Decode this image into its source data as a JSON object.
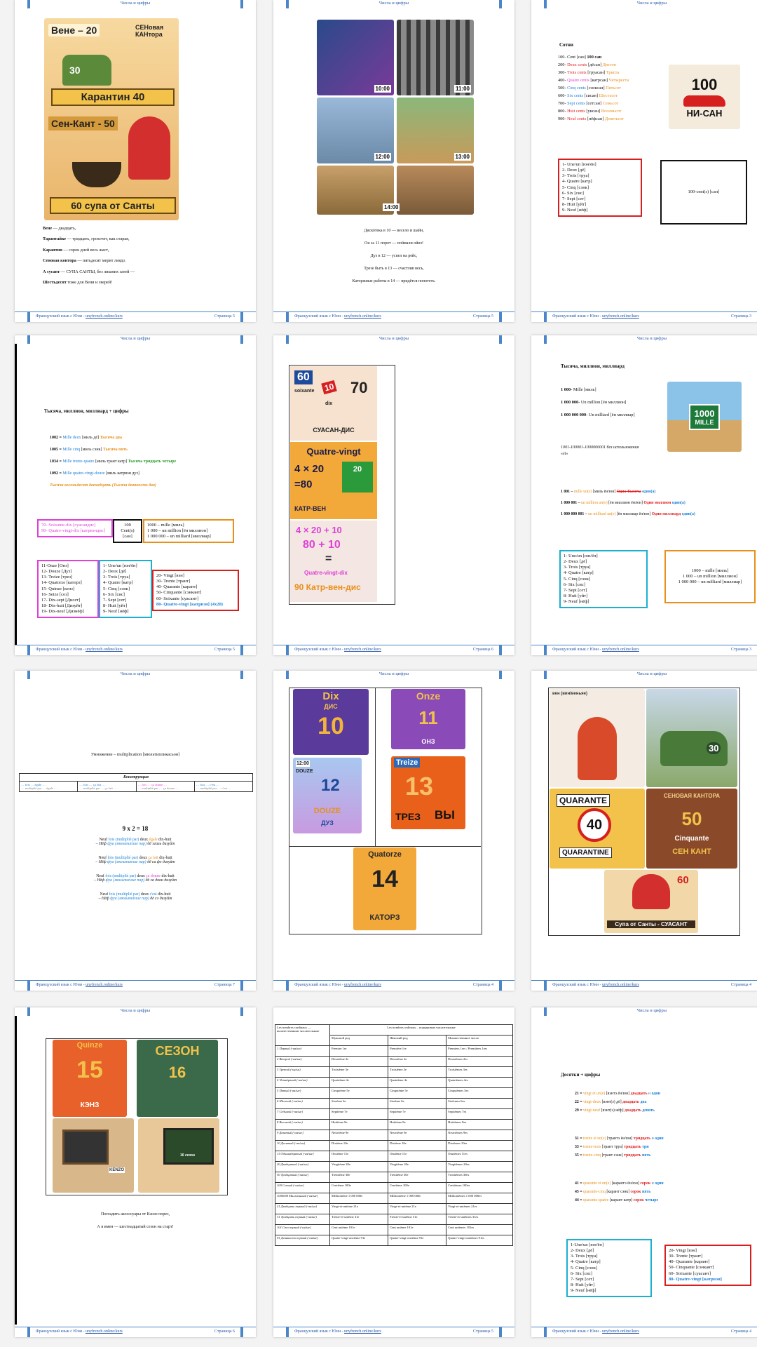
{
  "header_title": "Числа и цифры",
  "header_title_alt": "Числа и цифры",
  "footer": {
    "text": "Французский язык с Юни - ",
    "link": "unyfrench.online/kurs"
  },
  "colors": {
    "accent": "#4a86c8",
    "red": "#e02020",
    "blue": "#1a7fd6",
    "orange": "#e8901a",
    "pink": "#e040d8"
  },
  "p1": {
    "page_num": "Страница 5",
    "img": {
      "t1": "Вене – 20",
      "t2": "СЕНовая КАНтора",
      "car": "30",
      "quarantine": "Карантин 40",
      "sen": "Сен-Кант - 50",
      "soup": "60 супа от Санты"
    },
    "lines": [
      [
        "Вене",
        " — двадцать,"
      ],
      [
        "Тарантайке",
        " — тридцать, грохочет, как старая,"
      ],
      [
        "Карантин",
        " — сорок дней весь жаст,"
      ],
      [
        "Сеновая контора",
        " — пятьдесят мерит лиядз."
      ],
      [
        "А сусант",
        " — СУПА САНТЫ, без лишних затей —"
      ],
      [
        "Шестьдесят",
        " тоже для Вени и зверей!"
      ]
    ]
  },
  "p2": {
    "page_num": "Страница 5",
    "times": [
      "10:00",
      "11:00",
      "12:00",
      "13:00",
      "14:00"
    ],
    "lines": [
      "Дискотека в 10 — весело и шайн,",
      "Он за 11 порот — поймали ойнз!",
      "Дуз в 12 — успел на рейс,",
      "Трезе быть в 13 — счастлив весь,",
      "Каторжные работы в 14 — придётся попотеть."
    ]
  },
  "p3": {
    "page_num": "Страница 3",
    "title": "Сотни",
    "rows": [
      [
        "100- ",
        "Cent [сан] ",
        "100 сан",
        ""
      ],
      [
        "200- ",
        "Deux cents ",
        "[дёсан] ",
        "Двести"
      ],
      [
        "300- ",
        "Trois cents ",
        "[труасан] ",
        "Триста"
      ],
      [
        "400- ",
        "Quatre cents ",
        "[катрсан] ",
        "Четыреста"
      ],
      [
        "500- ",
        "Cinq cents ",
        "[сэнксан] ",
        "Пятьсот"
      ],
      [
        "600- ",
        "Six cents ",
        "[сисан] ",
        "Шестьсот"
      ],
      [
        "700- ",
        "Sept cents ",
        "[сетсан] ",
        "Семьсот"
      ],
      [
        "800- ",
        "Huit cents ",
        "[уисан] ",
        "Восемьсот"
      ],
      [
        "900- ",
        "Neuf cents ",
        "[нёфсан] ",
        "Девятьсот"
      ]
    ],
    "badge": {
      "num": "100",
      "txt": "НИ-САН"
    },
    "box_list": [
      "1- Une/un [юн/ён]",
      "2- Deux [дё]",
      "3- Trois [труа]",
      "4- Quatre [катр]",
      "5- Cinq [сэнк]",
      "6- Six [сис]",
      "7- Sept [сет]",
      "8- Huit [уйт]",
      "9- Neuf [нёф]"
    ],
    "box_cent": "100-cent(s) [сан]"
  },
  "p4": {
    "page_num": "Страница 5",
    "title": "Тысяча, миллион, миллиард + цифры",
    "rows": [
      [
        "1002 = ",
        "Mille deux ",
        "[миль дё] ",
        "Тысяча два"
      ],
      [
        "1005 = ",
        "Mille cinq ",
        "[миль сэнк] ",
        "Тысяча пять"
      ],
      [
        "1034 = ",
        "Mille trente-quatre ",
        "[миль трант катр] ",
        "Тысяча тридцать четыре"
      ],
      [
        "1092 = ",
        "Mille quatre-vingt-douze ",
        "[миль катрвэн дуз]",
        ""
      ]
    ],
    "note": "Тысяча восемьдесят двенадцать (Тысяча девяносто два)",
    "b1": [
      "70- Soixante-dix [суасандис]",
      "90- Quatre-vingt-dix [катрвэндис]"
    ],
    "b2": [
      "100",
      "Cent(s)",
      "[сан]"
    ],
    "b3": [
      "1000 – mille [миль]",
      "1 000 – un million [ён миллион]",
      "1 000 000 – un milliard [миллиар]"
    ],
    "b4": [
      "11-Onze [Онз]",
      "12- Douze [Дуз]",
      "13- Treize [трез]",
      "14- Quatorze [каторз]",
      "15- Quinze [кенз]",
      "16- Seize [сез]",
      "17- Dix-sept [Дисет]",
      "18- Dix-huit [Дизуйт]",
      "19- Dix-neuf [Дизнёф]"
    ],
    "b5": [
      "1- Une/un [юн/ён]",
      "2- Deux [дё]",
      "3- Trois [труа]",
      "4- Quatre [катр]",
      "5- Cinq [сэнк]",
      "6- Six [сис]",
      "7- Sept [сет]",
      "8- Huit [уйт]",
      "9- Neuf [нёф]"
    ],
    "b6": [
      "20- Vingt [вэн]",
      "30- Trente [трант]",
      "40- Quarante [карант]",
      "50- Cinquante [сэнкант]",
      "60- Soixante [суасант]",
      "80- Quatre-vingt [катрвэн] (4x20)"
    ]
  },
  "p5": {
    "page_num": "Страница 6",
    "a1": "60",
    "a2": "soixante",
    "a3": "10",
    "a4": "dix",
    "a5": "70",
    "a6": "СУАСАН-ДИС",
    "b1": "Quatre-vingt",
    "b2": "4 × 20",
    "b3": "=80",
    "b4": "20",
    "b5": "КАТР-ВЕН",
    "c1": "4 × 20 + 10",
    "c2": "80 + 10",
    "c3": "=",
    "c4": "Quatre-vingt-dix",
    "c5": "90 Катр-вен-дис"
  },
  "p6": {
    "page_num": "Страница 3",
    "title": "Тысяча, миллион, миллиард",
    "rows": [
      [
        "1 000- ",
        "Mille [миль]"
      ],
      [
        "1 000 000- ",
        "Un million [ён миллион]"
      ],
      [
        "1 000 000 000- ",
        "Un milliard [ён миллиар]"
      ]
    ],
    "note": "1001-100001-1000000001 без использования «et»",
    "sign1": "1000",
    "sign2": "MILLE",
    "rows2": [
      [
        "1 001 – ",
        "mille un(e) ",
        "[миль ён/юн] ",
        "Одна Тысяча",
        " один(а)"
      ],
      [
        "1 000 001 – ",
        "un million un(e) ",
        "[ён миллион ён/юн] ",
        "Один миллион",
        " один(а)"
      ],
      [
        "1 000 000 001 – ",
        "un milliard un(e) ",
        "[ён миллиар ён/юн] ",
        "Один миллиард",
        " один(а)"
      ]
    ],
    "box_list": [
      "1- Une/un [юн/ён]",
      "2- Deux [дё]",
      "3- Trois [труа]",
      "4- Quatre [катр]",
      "5- Cinq [сэнк]",
      "6- Six [сис]",
      "7- Sept [сет]",
      "8- Huit [уйт]",
      "9- Neuf [нёф]"
    ],
    "box_big": [
      "1000 – mille [миль]",
      "1 000 – un million [миллион]",
      "1 000 000 – un milliard [миллиар]"
    ]
  },
  "p7": {
    "page_num": "Страница 7",
    "title": "Умножение – multiplication [мюльтипликасьон]",
    "table_title": "Конструкция",
    "cells": [
      "… fois … égale …",
      "… fois … ça fait …",
      "… fois … ça donne …",
      "… fois … c'est …"
    ],
    "cells2": [
      "… multiplié par … égale …",
      "… multiplié par … ça fait …",
      "… multiplié par … ça donne …",
      "… multiplié par … c'est …"
    ],
    "eq": "9 x 2 = 18",
    "ex": [
      [
        "Neuf ",
        "fois (multiplié par) ",
        "deux ",
        "égale ",
        "dix-huit"
      ],
      [
        "– Нёф ",
        "фуа (мюльтиплие пар) ",
        "дё эгаль дизуйт",
        "",
        ""
      ],
      [
        "Neuf ",
        "fois (multiplié par) ",
        "deux ",
        "ça fait ",
        "dix-huit"
      ],
      [
        "– Нёф ",
        "фуа (мюльтиплие пар) ",
        "дё са фэ дизуйт",
        "",
        ""
      ],
      [
        "Neuf ",
        "fois (multiplié par) ",
        "deux ",
        "ça donne ",
        "dix-huit"
      ],
      [
        "– Нёф ",
        "фуа (мюльтиплие пар) ",
        "дё са донн дизуйт",
        "",
        ""
      ],
      [
        "Neuf ",
        "fois (multiplié par) ",
        "deux ",
        "c'est ",
        "dix-huit"
      ],
      [
        "– Нёф ",
        "фуа (мюльтиплие пар) ",
        "дё сэ дизуйт",
        "",
        ""
      ]
    ]
  },
  "p8": {
    "page_num": "Страница 4",
    "a1": "Dix",
    "a2": "ДИС",
    "a3": "10",
    "b1": "Onze",
    "b2": "11",
    "b3": "ОНЗ",
    "c1": "12:00",
    "c2": "DOUZE",
    "c3": "12",
    "c4": "DOUZE",
    "c5": "ДУЗ",
    "d1": "Treize",
    "d2": "13",
    "d3": "ТРЕЗ",
    "d4": "ВЫ",
    "e1": "Quatorze",
    "e2": "14",
    "e3": "КАТОРЗ"
  },
  "p9": {
    "page_num": "Страница 4",
    "a1": "вен (вин/веньяе)",
    "b1": "30",
    "c1": "QUARANTE",
    "c2": "40",
    "c3": "QUARANTINE",
    "d1": "СЕНОВАЯ КАНТОРА",
    "d2": "50",
    "d3": "Cinquante",
    "d4": "СЕН КАНТ",
    "e1": "60",
    "e2": "Супа от Санты - СУАСАНТ"
  },
  "p10": {
    "page_num": "Страница 6",
    "a1": "Quinze",
    "a2": "15",
    "a3": "КЭНЗ",
    "b1": "СЕЗОН",
    "b2": "16",
    "c1": "KENZO",
    "d1": "16 сезон",
    "lines": [
      "Погладить аксессуары от Кэнзо порез,",
      "А я имен — шестнадцатый сезон на старт!"
    ]
  },
  "p11": {
    "page_num": "Страница 5",
    "h1": "Les nombres cardinaux — количественные числительные",
    "h2": "Les nombres ordinaux – порядковые числительные",
    "cols": [
      "Мужской род",
      "Женский род",
      "Множественное число"
    ],
    "rows": [
      [
        "1 Первый (-ая/ые)",
        "Premier 1er",
        "Première 1re",
        "Premiers 1ers / Premières 1res"
      ],
      [
        "2 Второй (-ая/ые)",
        "Deuxième 2e",
        "Deuxième 2e",
        "Deuxièmes 2es"
      ],
      [
        "3 Третий (-ья/ьи)",
        "Troisième 3e",
        "Troisième 3e",
        "Troisièmes 3es"
      ],
      [
        "4 Четвёртый (-ая/ые)",
        "Quatrième 4e",
        "Quatrième 4e",
        "Quatrièmes 4es"
      ],
      [
        "5 Пятый (-ая/ые)",
        "Cinquième 5e",
        "Cinquième 5e",
        "Cinquièmes 5es"
      ],
      [
        "6 Шестой (-ая/ые)",
        "Sixième 6e",
        "Sixième 6e",
        "Sixièmes 6es"
      ],
      [
        "7 Седьмой (-ая/ые)",
        "Septième 7e",
        "Septième 7e",
        "Septièmes 7es"
      ],
      [
        "8 Восьмой (-ая/ые)",
        "Huitième 8e",
        "Huitième 8e",
        "Huitièmes 8es"
      ],
      [
        "9 Девятый (-ая/ые)",
        "Neuvième 9e",
        "Neuvième 9e",
        "Neuvièmes 9es"
      ],
      [
        "10 Десятый (-ая/ые)",
        "Dixième 10e",
        "Dixième 10e",
        "Dixièmes 10es"
      ],
      [
        "11 Одиннадцатый (-ая/ые)",
        "Onzième 11e",
        "Onzième 11e",
        "Onzièmes 11es"
      ],
      [
        "20 Двадцатый (-ая/ые)",
        "Vingtième 20e",
        "Vingtième 20e",
        "Vingtièmes 20es"
      ],
      [
        "30 Тридцатый (-ая/ые)",
        "Trentième 30e",
        "Trentième 30e",
        "Trentièmes 30es"
      ],
      [
        "100 Сотый (-ая/ые)",
        "Centième 100e",
        "Centième 100e",
        "Centièmes 100es"
      ],
      [
        "1000000 Миллионный (-ая/ые)",
        "Millionième 1 000 000e",
        "Millionième 1 000 000e",
        "Millionièmes 1 000 000es"
      ],
      [
        "21 Двадцать первый (-ая/ые)",
        "Vingt-et-unième 21e",
        "Vingt-et-unième 21e",
        "Vingt-et-unièmes 21es"
      ],
      [
        "31 Тридцать первый (-ая/ые)",
        "Trente-et-unième 31e",
        "Trente-et-unième 31e",
        "Trente-et-unièmes 31es"
      ],
      [
        "101 Сто первый (-ая/ые)",
        "Cent unième 101e",
        "Cent unième 101e",
        "Cent unièmes 101es"
      ],
      [
        "91 Девяносто первый (-ая/ые)",
        "Quatre-vingt-onzième 91e",
        "Quatre-vingt-onzième 91e",
        "Quatre-vingt-onzièmes 91es"
      ]
    ]
  },
  "p12": {
    "page_num": "Страница 4",
    "title": "Десятки + цифры",
    "groups": [
      [
        [
          "21 = ",
          "vingt et un(e) ",
          "[вэнтэ ён/юн] ",
          "двадцать",
          " и ",
          "один"
        ],
        [
          "22 = ",
          "vingt-deux ",
          "[вэнт(э) дё] ",
          "двадцать",
          " ",
          "два"
        ],
        [
          "29 = ",
          "vingt-neuf ",
          "[вэнт(э) нёф] ",
          "двадцать",
          " ",
          "девять"
        ]
      ],
      [
        [
          "31 = ",
          "trente et un(e) ",
          "[трантэ ён/юн] ",
          "тридцать",
          " и ",
          "один"
        ],
        [
          "33 = ",
          "trente-trois ",
          "[трант труа] ",
          "тридцать",
          " ",
          "три"
        ],
        [
          "35 = ",
          "trente-cinq ",
          "[трант сэнк] ",
          "тридцать",
          " ",
          "пять"
        ]
      ],
      [
        [
          "41 = ",
          "quarante et un(e) ",
          "[карантэ ён/юн] ",
          "сорок",
          " и ",
          "один"
        ],
        [
          "45 = ",
          "quarante-cinq ",
          "[карант сэнк] ",
          "сорок",
          " ",
          "пять"
        ],
        [
          "44 = ",
          "quarante-quatre ",
          "[карант катр] ",
          "сорок",
          " ",
          "четыре"
        ]
      ]
    ],
    "box_list": [
      "1-Une/un [юн/ён]",
      "2- Deux [дё]",
      "3- Trois [труа]",
      "4- Quatre [катр]",
      "5- Cinq [сэнк]",
      "6- Six [сис]",
      "7- Sept [сет]",
      "8- Huit [уйт]",
      "9- Neuf [нёф]"
    ],
    "box_tens": [
      "20- Vingt [вэн]",
      "30- Trente [трант]",
      "40- Quarante [карант]",
      "50- Cinquante [сэнкант]",
      "60- Soixante [суасант]",
      "80- Quatre-vingt [катрвэн]"
    ]
  }
}
